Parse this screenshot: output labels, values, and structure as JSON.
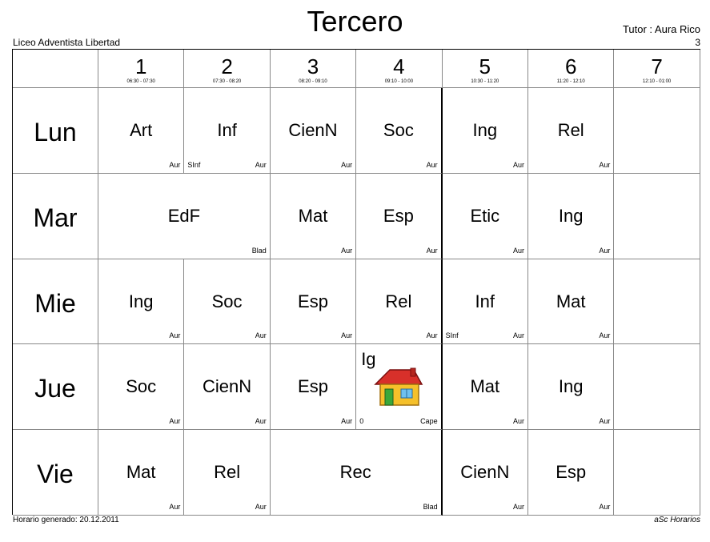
{
  "header": {
    "title": "Tercero",
    "school": "Liceo Adventista Libertad",
    "tutor": "Tutor : Aura Rico",
    "class_number": "3"
  },
  "footer": {
    "generated": "Horario generado: 20.12.2011",
    "software": "aSc Horarios"
  },
  "periods": [
    {
      "num": "1",
      "time": "06:30 - 07:30"
    },
    {
      "num": "2",
      "time": "07:30 - 08:20"
    },
    {
      "num": "3",
      "time": "08:20 - 09:10"
    },
    {
      "num": "4",
      "time": "09:10 - 10:00"
    },
    {
      "num": "5",
      "time": "10:30 - 11:20"
    },
    {
      "num": "6",
      "time": "11:20 - 12:10"
    },
    {
      "num": "7",
      "time": "12:10 - 01:00"
    }
  ],
  "days": [
    {
      "name": "Lun",
      "lessons": [
        {
          "start": 1,
          "span": 1,
          "subject": "Art",
          "teacher": "Aur",
          "room": ""
        },
        {
          "start": 2,
          "span": 1,
          "subject": "Inf",
          "teacher": "Aur",
          "room": "SInf"
        },
        {
          "start": 3,
          "span": 1,
          "subject": "CienN",
          "teacher": "Aur",
          "room": ""
        },
        {
          "start": 4,
          "span": 1,
          "subject": "Soc",
          "teacher": "Aur",
          "room": ""
        },
        {
          "start": 5,
          "span": 1,
          "subject": "Ing",
          "teacher": "Aur",
          "room": ""
        },
        {
          "start": 6,
          "span": 1,
          "subject": "Rel",
          "teacher": "Aur",
          "room": ""
        },
        {
          "start": 7,
          "span": 1,
          "subject": "",
          "teacher": "",
          "room": ""
        }
      ]
    },
    {
      "name": "Mar",
      "lessons": [
        {
          "start": 1,
          "span": 2,
          "subject": "EdF",
          "teacher": "Blad",
          "room": ""
        },
        {
          "start": 3,
          "span": 1,
          "subject": "Mat",
          "teacher": "Aur",
          "room": ""
        },
        {
          "start": 4,
          "span": 1,
          "subject": "Esp",
          "teacher": "Aur",
          "room": ""
        },
        {
          "start": 5,
          "span": 1,
          "subject": "Etic",
          "teacher": "Aur",
          "room": ""
        },
        {
          "start": 6,
          "span": 1,
          "subject": "Ing",
          "teacher": "Aur",
          "room": ""
        },
        {
          "start": 7,
          "span": 1,
          "subject": "",
          "teacher": "",
          "room": ""
        }
      ]
    },
    {
      "name": "Mie",
      "lessons": [
        {
          "start": 1,
          "span": 1,
          "subject": "Ing",
          "teacher": "Aur",
          "room": ""
        },
        {
          "start": 2,
          "span": 1,
          "subject": "Soc",
          "teacher": "Aur",
          "room": ""
        },
        {
          "start": 3,
          "span": 1,
          "subject": "Esp",
          "teacher": "Aur",
          "room": ""
        },
        {
          "start": 4,
          "span": 1,
          "subject": "Rel",
          "teacher": "Aur",
          "room": ""
        },
        {
          "start": 5,
          "span": 1,
          "subject": "Inf",
          "teacher": "Aur",
          "room": "SInf"
        },
        {
          "start": 6,
          "span": 1,
          "subject": "Mat",
          "teacher": "Aur",
          "room": ""
        },
        {
          "start": 7,
          "span": 1,
          "subject": "",
          "teacher": "",
          "room": ""
        }
      ]
    },
    {
      "name": "Jue",
      "lessons": [
        {
          "start": 1,
          "span": 1,
          "subject": "Soc",
          "teacher": "Aur",
          "room": ""
        },
        {
          "start": 2,
          "span": 1,
          "subject": "CienN",
          "teacher": "Aur",
          "room": ""
        },
        {
          "start": 3,
          "span": 1,
          "subject": "Esp",
          "teacher": "Aur",
          "room": ""
        },
        {
          "start": 4,
          "span": 1,
          "subject": "Ig",
          "teacher": "Cape",
          "room": "0",
          "icon": "house-icon"
        },
        {
          "start": 5,
          "span": 1,
          "subject": "Mat",
          "teacher": "Aur",
          "room": ""
        },
        {
          "start": 6,
          "span": 1,
          "subject": "Ing",
          "teacher": "Aur",
          "room": ""
        },
        {
          "start": 7,
          "span": 1,
          "subject": "",
          "teacher": "",
          "room": ""
        }
      ]
    },
    {
      "name": "Vie",
      "lessons": [
        {
          "start": 1,
          "span": 1,
          "subject": "Mat",
          "teacher": "Aur",
          "room": ""
        },
        {
          "start": 2,
          "span": 1,
          "subject": "Rel",
          "teacher": "Aur",
          "room": ""
        },
        {
          "start": 3,
          "span": 2,
          "subject": "Rec",
          "teacher": "Blad",
          "room": ""
        },
        {
          "start": 5,
          "span": 1,
          "subject": "CienN",
          "teacher": "Aur",
          "room": ""
        },
        {
          "start": 6,
          "span": 1,
          "subject": "Esp",
          "teacher": "Aur",
          "room": ""
        },
        {
          "start": 7,
          "span": 1,
          "subject": "",
          "teacher": "",
          "room": ""
        }
      ]
    }
  ]
}
